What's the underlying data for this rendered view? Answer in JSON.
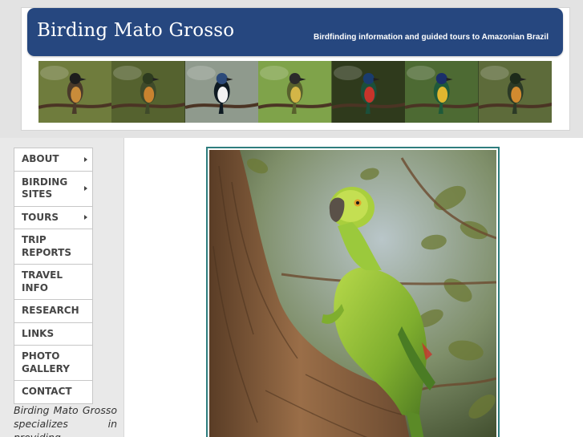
{
  "header": {
    "site_title": "Birding Mato Grosso",
    "tagline": "Birdfinding information and guided tours to Amazonian Brazil",
    "colors": {
      "banner": "#26477f",
      "header_bg": "#e3e3e3"
    },
    "strip_photos": [
      {
        "kind": "bird-photo",
        "bg": "#6f7c3d",
        "body": "#4a3a2a",
        "belly": "#c98c3a",
        "cap": "#1d1d1d"
      },
      {
        "kind": "bird-photo",
        "bg": "#55622f",
        "body": "#3f4a2a",
        "belly": "#c9822f",
        "cap": "#2d3b1f"
      },
      {
        "kind": "bird-photo",
        "bg": "#8f9a8d",
        "body": "#0e1a22",
        "belly": "#f2f2f2",
        "cap": "#2c4a7a"
      },
      {
        "kind": "bird-photo",
        "bg": "#7fa34a",
        "body": "#58612d",
        "belly": "#d3b547",
        "cap": "#2b2b2b"
      },
      {
        "kind": "bird-photo",
        "bg": "#2f3a1c",
        "body": "#1b4f3a",
        "belly": "#c7342b",
        "cap": "#1a3c6e"
      },
      {
        "kind": "bird-photo",
        "bg": "#4d6a33",
        "body": "#1f5a3a",
        "belly": "#e0b72f",
        "cap": "#1a2f6a"
      },
      {
        "kind": "bird-photo",
        "bg": "#5d6b3a",
        "body": "#2c3a26",
        "belly": "#d28a2f",
        "cap": "#1d2b1a"
      }
    ]
  },
  "nav": {
    "items": [
      {
        "label": "ABOUT",
        "has_submenu": true
      },
      {
        "label": "BIRDING SITES",
        "has_submenu": true
      },
      {
        "label": "TOURS",
        "has_submenu": true
      },
      {
        "label": "TRIP REPORTS",
        "has_submenu": false
      },
      {
        "label": "TRAVEL INFO",
        "has_submenu": false
      },
      {
        "label": "RESEARCH",
        "has_submenu": false
      },
      {
        "label": "LINKS",
        "has_submenu": false
      },
      {
        "label": "PHOTO GALLERY",
        "has_submenu": false
      },
      {
        "label": "CONTACT",
        "has_submenu": false
      }
    ]
  },
  "sidebar": {
    "intro_text": "Birding Mato Grosso specializes in providing customized"
  },
  "main": {
    "photo": {
      "kind": "parrot-photo",
      "frame_color": "#2e7d7e"
    }
  }
}
